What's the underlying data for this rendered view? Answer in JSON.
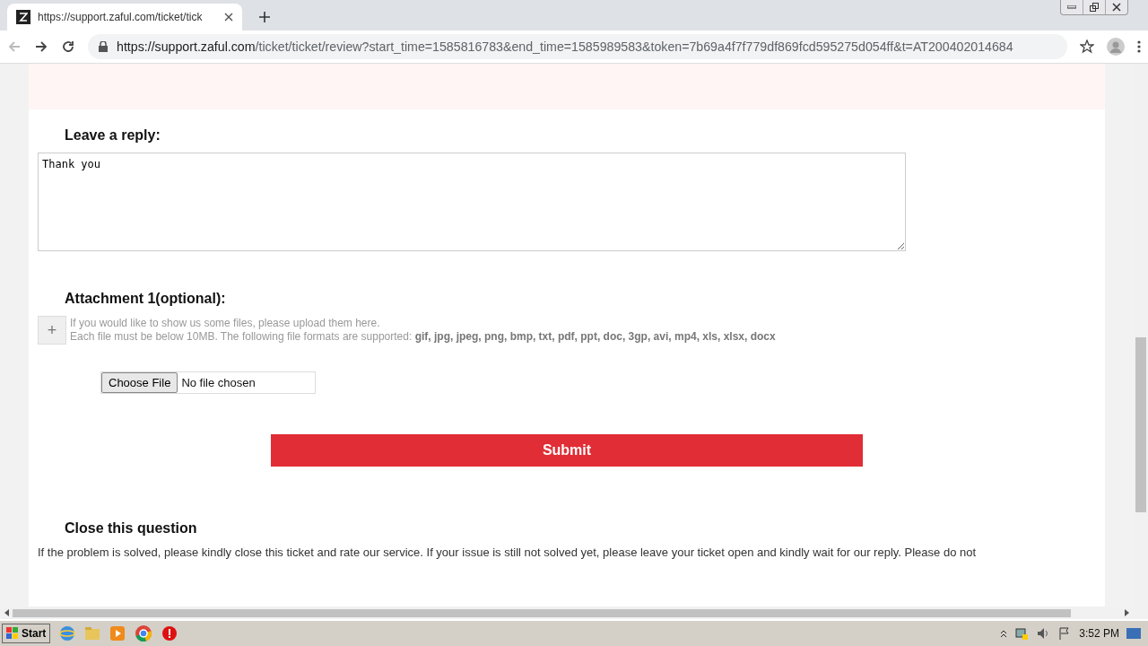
{
  "browser": {
    "tab_title": "https://support.zaful.com/ticket/tick",
    "url_host": "https://support.zaful.com",
    "url_path": "/ticket/ticket/review?start_time=1585816783&end_time=1585989583&token=7b69a4f7f779df869fcd595275d054ff&t=AT200402014684"
  },
  "reply": {
    "heading": "Leave a reply:",
    "value": "Thank you"
  },
  "attachment": {
    "heading": "Attachment 1(optional):",
    "add": "+",
    "hint": "If you would like to show us some files, please upload them here.",
    "formats": "Each file must be below 10MB. The following file formats are supported: **gif, jpg, jpeg, png, bmp, txt, pdf, ppt, doc, 3gp, avi, mp4, xls, xlsx, docx**",
    "choose_button": "Choose File",
    "file_status": "No file chosen"
  },
  "submit": "Submit",
  "close_section": {
    "heading": "Close this question",
    "text": "If the problem is solved, please kindly close this ticket and rate our service. If your issue is still not solved yet, please leave your ticket open and kindly wait for our reply. Please do not"
  },
  "taskbar": {
    "start": "Start",
    "time": "3:52 PM"
  }
}
